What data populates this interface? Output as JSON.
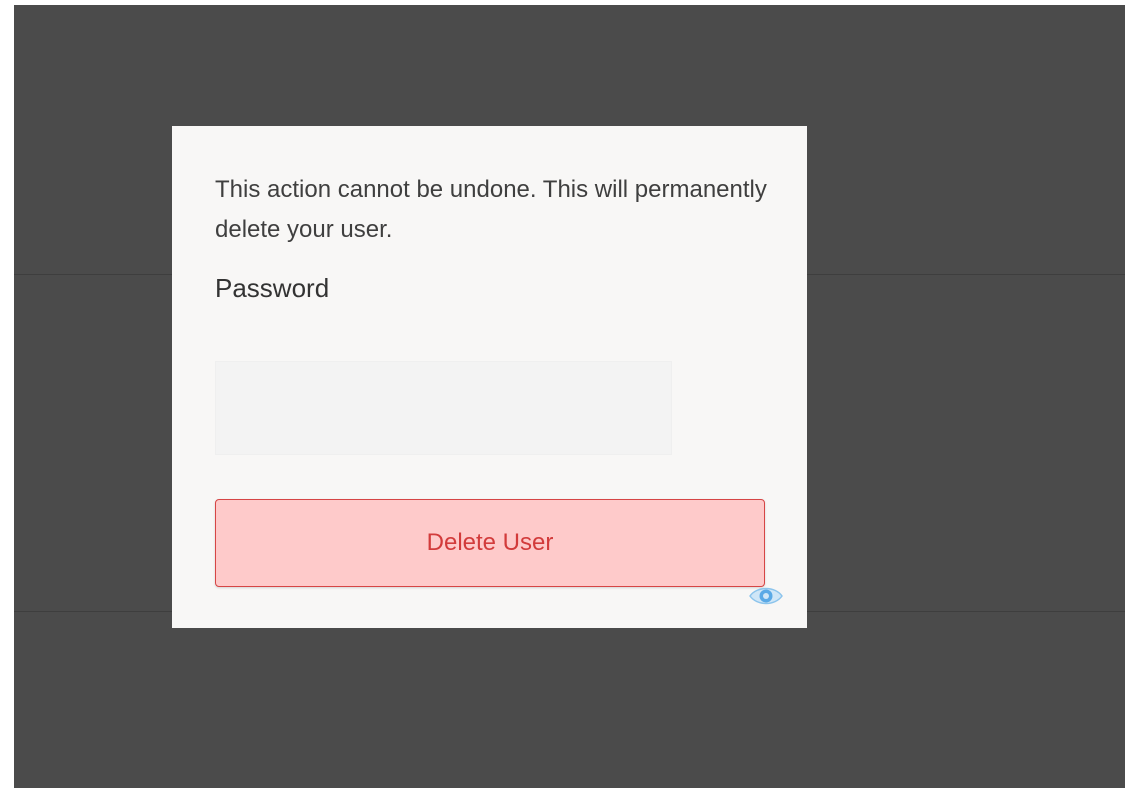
{
  "dialog": {
    "message": "This action cannot be undone. This will permanently delete your user.",
    "password_label": "Password",
    "password_value": "",
    "password_placeholder": "",
    "delete_button_label": "Delete User"
  },
  "icons": {
    "password_toggle": "eye-icon"
  },
  "colors": {
    "backdrop": "#4b4b4b",
    "dialog_background": "#f8f7f6",
    "danger_fill": "#fecaca",
    "danger_border": "#d64545",
    "danger_text": "#d23b3b",
    "eye_icon": "#5aa9e6"
  }
}
